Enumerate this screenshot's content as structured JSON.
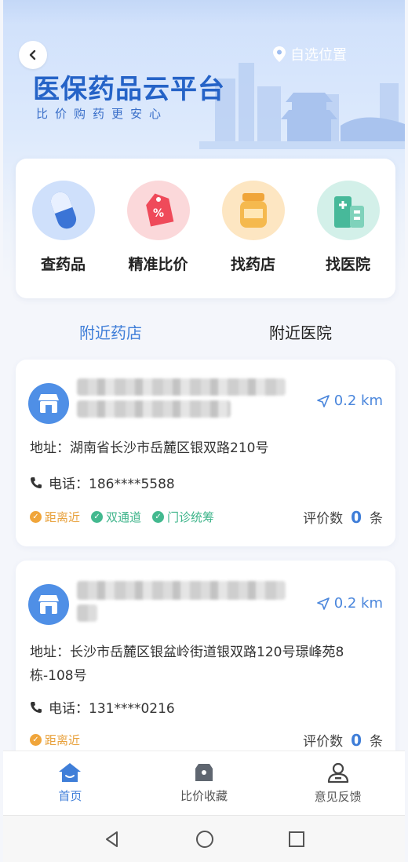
{
  "header": {
    "location_label": "自选位置",
    "title": "医保药品云平台",
    "subtitle": "比价购药更安心"
  },
  "quick_actions": [
    {
      "label": "查药品",
      "icon": "pill-capsule-icon"
    },
    {
      "label": "精准比价",
      "icon": "price-tag-icon"
    },
    {
      "label": "找药店",
      "icon": "medicine-bottle-icon"
    },
    {
      "label": "找医院",
      "icon": "hospital-building-icon"
    }
  ],
  "tabs": [
    {
      "label": "附近药店",
      "active": true
    },
    {
      "label": "附近医院",
      "active": false
    }
  ],
  "stores": [
    {
      "distance": "0.2 km",
      "address": "地址：湖南省长沙市岳麓区银双路210号",
      "phone": "电话：186****5588",
      "tags": [
        {
          "label": "距离近",
          "color": "orange"
        },
        {
          "label": "双通道",
          "color": "green"
        },
        {
          "label": "门诊统筹",
          "color": "green"
        }
      ],
      "rating_label": "评价数",
      "rating_count": "0",
      "rating_unit": "条"
    },
    {
      "distance": "0.2 km",
      "address": "地址：长沙市岳麓区银盆岭街道银双路120号璟峰苑8栋-108号",
      "phone": "电话：131****0216",
      "tags": [
        {
          "label": "距离近",
          "color": "orange"
        }
      ],
      "rating_label": "评价数",
      "rating_count": "0",
      "rating_unit": "条"
    }
  ],
  "bottom_nav": [
    {
      "label": "首页",
      "active": true
    },
    {
      "label": "比价收藏",
      "active": false
    },
    {
      "label": "意见反馈",
      "active": false
    }
  ],
  "colors": {
    "accent": "#3f7ed8",
    "title_blue": "#2563c7",
    "tag_orange": "#f0a53a",
    "tag_green": "#43b98f"
  }
}
